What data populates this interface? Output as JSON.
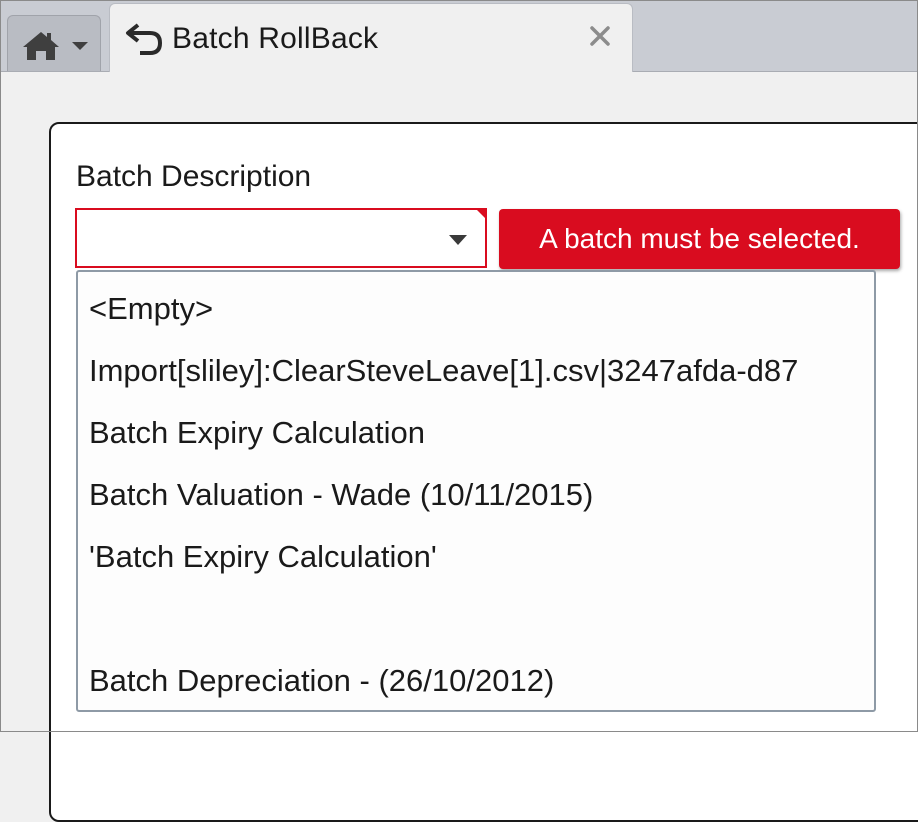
{
  "tabs": {
    "home": {
      "icon": "home-icon",
      "menu_icon": "chevron-down-icon"
    },
    "active": {
      "label": "Batch RollBack",
      "icon": "undo-icon",
      "close_icon": "close-icon"
    }
  },
  "form": {
    "batch_description": {
      "label": "Batch Description",
      "value": "",
      "error": "A batch must be selected."
    }
  },
  "dropdown": {
    "options": [
      "<Empty>",
      "Import[sliley]:ClearSteveLeave[1].csv|3247afda-d87",
      "Batch Expiry Calculation",
      "Batch Valuation - Wade (10/11/2015)",
      "'Batch Expiry Calculation'",
      "",
      "Batch Depreciation -  (26/10/2012)"
    ]
  },
  "colors": {
    "error": "#d90c1f",
    "tabstrip": "#c9ccd3",
    "background": "#f0f0f0"
  }
}
